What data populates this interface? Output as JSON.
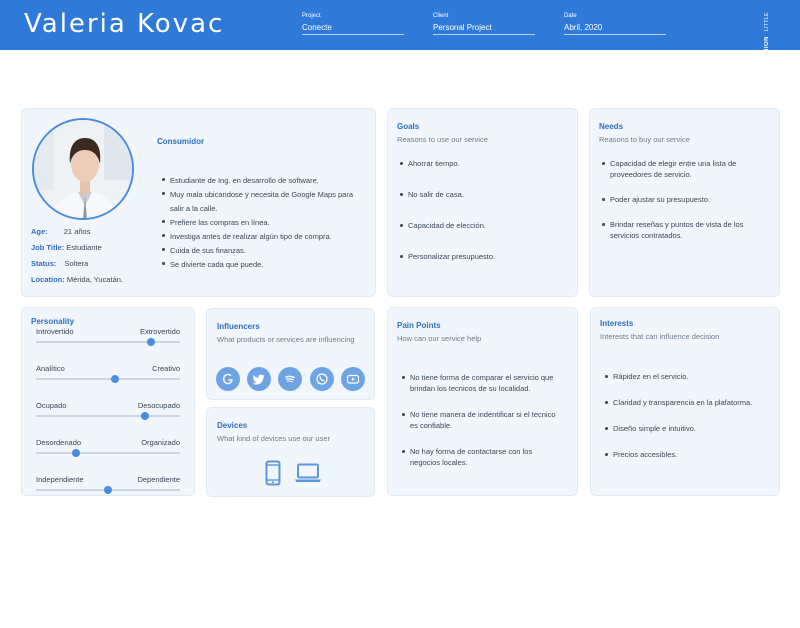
{
  "header": {
    "name": "Valeria Kovac",
    "project_label": "Project",
    "project_value": "Conecte",
    "client_label": "Client",
    "client_value": "Personal Project",
    "date_label": "Date",
    "date_value": "Abril, 2020",
    "brand_small": "LITTLE",
    "brand_big": "NION"
  },
  "profile": {
    "role": "Consumidor",
    "bullets": [
      "Estudiante de Ing. en desarrollo de software.",
      "Muy mala ubicandose y necesita de Google Maps para salir a la calle.",
      "Prefiere las compras en línea.",
      "Investiga antes de realizar algún tipo de compra.",
      "Cuida de sus finanzas.",
      "Se divierte cada que puede."
    ],
    "age_label": "Age:",
    "age_value": "21 años",
    "job_label": "Job Title:",
    "job_value": "Estudiante",
    "status_label": "Status:",
    "status_value": "Soltera",
    "location_label": "Location:",
    "location_value": "Mérida, Yucatán."
  },
  "goals": {
    "title": "Goals",
    "subtitle": "Reasons to use our service",
    "items": [
      "Ahorrar tiempo.",
      "No salir de casa.",
      "Capacidad de elección.",
      "Personalizar presupuesto."
    ]
  },
  "needs": {
    "title": "Needs",
    "subtitle": "Reasons to buy our service",
    "items": [
      "Capacidad de elegir entre una lista de proveedores de servicio.",
      "Poder ajustar su presupuesto.",
      "Brindar reseñas y puntos de vista de los servicios contratados."
    ]
  },
  "personality": {
    "title": "Personality",
    "sliders": [
      {
        "left": "Introvertido",
        "right": "Extrovertido",
        "value": 0.8
      },
      {
        "left": "Analítico",
        "right": "Creativo",
        "value": 0.55
      },
      {
        "left": "Ocupado",
        "right": "Desocupado",
        "value": 0.76
      },
      {
        "left": "Desordenado",
        "right": "Organizado",
        "value": 0.28
      },
      {
        "left": "Independiente",
        "right": "Dependiente",
        "value": 0.5
      }
    ]
  },
  "influencers": {
    "title": "Influencers",
    "subtitle": "What products or services are influencing",
    "icons": [
      "google-icon",
      "twitter-icon",
      "spotify-icon",
      "whatsapp-icon",
      "youtube-icon"
    ]
  },
  "devices": {
    "title": "Devices",
    "subtitle": "What kind of devices use our user",
    "icons": [
      "smartphone-icon",
      "laptop-icon"
    ]
  },
  "pain_points": {
    "title": "Pain Points",
    "subtitle": "How can our service help",
    "items": [
      "No tiene forma de comparar el servicio que brindan los tecnicos de su localidad.",
      "No tiene manera de indentificar si el tecnico es confiable.",
      "No hay forma de contactarse con los negocios locales."
    ]
  },
  "interests": {
    "title": "Interests",
    "subtitle": "Interests that can influence decision",
    "items": [
      "Rápidez en el servicio.",
      "Claridad y transparencia en la plafatorma.",
      "Diseño simple e intuitivo.",
      "Precios accesibles."
    ]
  },
  "colors": {
    "header": "#2f7ad8",
    "accent": "#4a8ce0",
    "card": "#f1f6fc",
    "title": "#2f6fbf"
  }
}
